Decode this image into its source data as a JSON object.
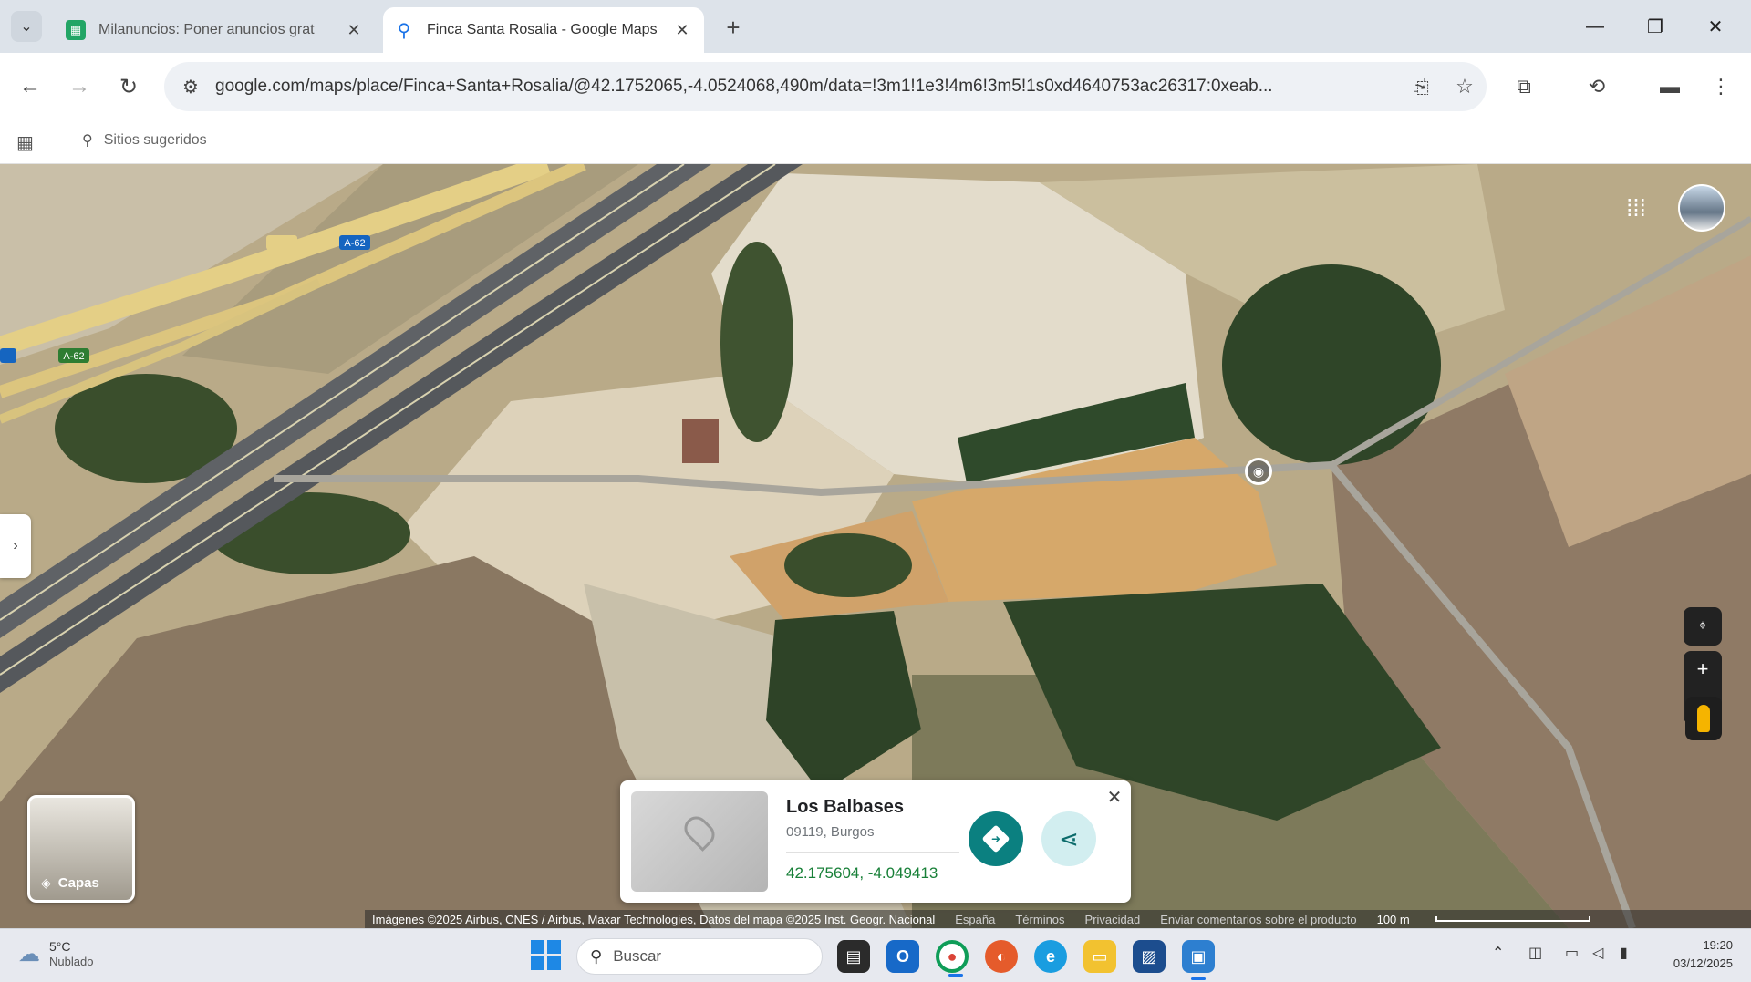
{
  "browser": {
    "tabs": [
      {
        "title": "Milanuncios: Poner anuncios grat",
        "favicon": "sheets-icon",
        "active": false
      },
      {
        "title": "Finca Santa Rosalia - Google Maps",
        "favicon": "maps-pin-icon",
        "active": true
      }
    ],
    "url": "google.com/maps/place/Finca+Santa+Rosalia/@42.1752065,-4.0524068,490m/data=!3m1!1e3!4m6!3m5!1s0xd4640753ac26317:0xeab...",
    "bookmarks": {
      "suggested_sites": "Sitios sugeridos"
    }
  },
  "map": {
    "road_labels": [
      "A-62",
      "A-62",
      "A-62",
      "A-62"
    ],
    "layers_label": "Capas",
    "place_card": {
      "name": "Los Balbases",
      "address": "09119, Burgos",
      "coords": "42.175604, -4.049413"
    },
    "attribution": {
      "imagery": "Imágenes ©2025 Airbus, CNES / Airbus, Maxar Technologies, Datos del mapa ©2025 Inst. Geogr. Nacional",
      "links": [
        "España",
        "Términos",
        "Privacidad",
        "Enviar comentarios sobre el producto"
      ],
      "scale": "100 m"
    }
  },
  "taskbar": {
    "weather_temp": "5°C",
    "weather_cond": "Nublado",
    "search_placeholder": "Buscar",
    "time": "19:20",
    "date": "03/12/2025"
  },
  "colors": {
    "accent": "#1a73e8",
    "directions_button": "#0b8080",
    "coords_text": "#188038"
  }
}
